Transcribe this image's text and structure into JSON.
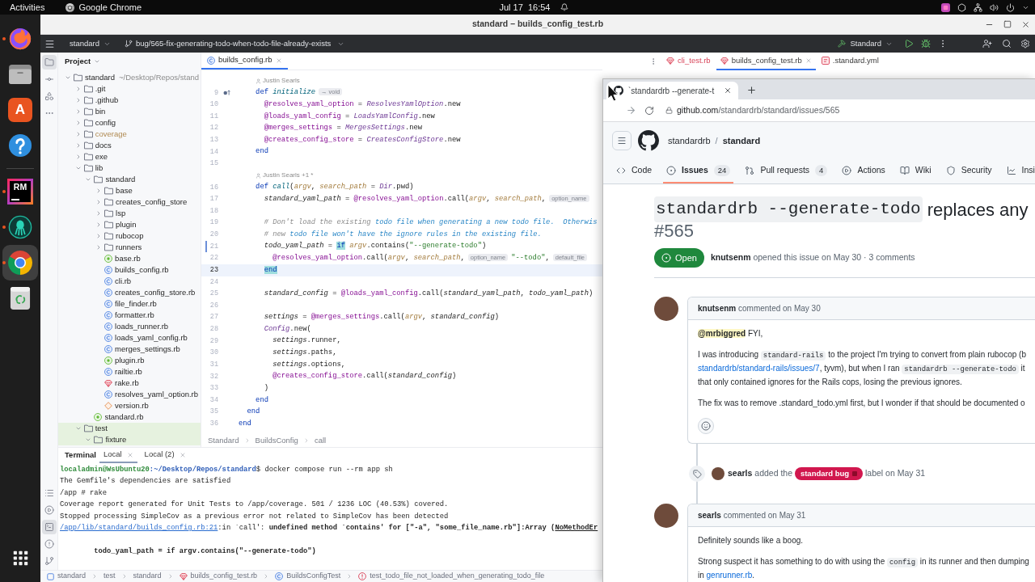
{
  "topbar": {
    "activities": "Activities",
    "app": "Google Chrome",
    "clock": "Jul 17  16:54"
  },
  "dock": [
    {
      "kind": "firefox",
      "running": true,
      "selected": false
    },
    {
      "kind": "files",
      "running": false,
      "selected": false
    },
    {
      "kind": "store",
      "label": "A",
      "running": false,
      "selected": false
    },
    {
      "kind": "help",
      "running": false,
      "selected": false
    },
    {
      "kind": "separator"
    },
    {
      "kind": "rubymine",
      "label": "RM",
      "running": true,
      "selected": false
    },
    {
      "kind": "kraken",
      "running": true,
      "selected": false
    },
    {
      "kind": "chrome",
      "running": true,
      "selected": true
    },
    {
      "kind": "trash",
      "running": false,
      "selected": false
    },
    {
      "kind": "grid",
      "selected": false
    }
  ],
  "ide": {
    "title": "standard – builds_config_test.rb",
    "project_widget": "standard",
    "branch": "bug/565-fix-generating-todo-when-todo-file-already-exists",
    "run_config": "Standard",
    "strip_top": [
      {
        "kind": "project",
        "selected": true
      },
      {
        "kind": "commit",
        "selected": false
      },
      {
        "kind": "structure",
        "selected": false
      },
      {
        "kind": "more",
        "selected": false
      }
    ],
    "strip_bottom": [
      {
        "kind": "services",
        "selected": false
      },
      {
        "kind": "run",
        "selected": false
      },
      {
        "kind": "terminal",
        "selected": true
      },
      {
        "kind": "problems",
        "selected": false
      },
      {
        "kind": "git",
        "selected": false
      }
    ],
    "project": {
      "title": "Project",
      "tree": [
        {
          "name": "standard",
          "path": "~/Desktop/Repos/stand",
          "kind": "folder",
          "expanded": true,
          "children": [
            {
              "name": ".git",
              "kind": "folder",
              "expanded": false
            },
            {
              "name": ".github",
              "kind": "folder",
              "expanded": false
            },
            {
              "name": "bin",
              "kind": "folder",
              "expanded": false
            },
            {
              "name": "config",
              "kind": "folder",
              "expanded": false
            },
            {
              "name": "coverage",
              "kind": "folder",
              "expanded": false,
              "excluded": true
            },
            {
              "name": "docs",
              "kind": "folder",
              "expanded": false
            },
            {
              "name": "exe",
              "kind": "folder",
              "expanded": false
            },
            {
              "name": "lib",
              "kind": "folder",
              "expanded": true,
              "children": [
                {
                  "name": "standard",
                  "kind": "folder",
                  "expanded": true,
                  "children": [
                    {
                      "name": "base",
                      "kind": "folder",
                      "expanded": false
                    },
                    {
                      "name": "creates_config_store",
                      "kind": "folder",
                      "expanded": false
                    },
                    {
                      "name": "lsp",
                      "kind": "folder",
                      "expanded": false
                    },
                    {
                      "name": "plugin",
                      "kind": "folder",
                      "expanded": false
                    },
                    {
                      "name": "rubocop",
                      "kind": "folder",
                      "expanded": false
                    },
                    {
                      "name": "runners",
                      "kind": "folder",
                      "expanded": false
                    },
                    {
                      "name": "base.rb",
                      "kind": "module"
                    },
                    {
                      "name": "builds_config.rb",
                      "kind": "class"
                    },
                    {
                      "name": "cli.rb",
                      "kind": "class"
                    },
                    {
                      "name": "creates_config_store.rb",
                      "kind": "class"
                    },
                    {
                      "name": "file_finder.rb",
                      "kind": "class"
                    },
                    {
                      "name": "formatter.rb",
                      "kind": "class"
                    },
                    {
                      "name": "loads_runner.rb",
                      "kind": "class"
                    },
                    {
                      "name": "loads_yaml_config.rb",
                      "kind": "class"
                    },
                    {
                      "name": "merges_settings.rb",
                      "kind": "class"
                    },
                    {
                      "name": "plugin.rb",
                      "kind": "module"
                    },
                    {
                      "name": "railtie.rb",
                      "kind": "class"
                    },
                    {
                      "name": "rake.rb",
                      "kind": "ruby"
                    },
                    {
                      "name": "resolves_yaml_option.rb",
                      "kind": "class"
                    },
                    {
                      "name": "version.rb",
                      "kind": "diamond"
                    }
                  ]
                },
                {
                  "name": "standard.rb",
                  "kind": "module"
                }
              ]
            },
            {
              "name": "test",
              "kind": "folder",
              "expanded": true,
              "test_scope": true,
              "children": [
                {
                  "name": "fixture",
                  "kind": "folder",
                  "expanded": true,
                  "test_scope": true
                }
              ]
            }
          ]
        }
      ]
    },
    "editor": {
      "tabs": [
        {
          "label": "builds_config.rb",
          "kind": "class",
          "selected": true
        }
      ],
      "lines": [
        {
          "kind": "author",
          "text": "Justin Searls"
        },
        {
          "kind": "code",
          "number": "9",
          "current": false,
          "override_marker": true,
          "tokens": [
            {
              "kind": "keyword",
              "text": "    def "
            },
            {
              "kind": "method",
              "text": "initialize"
            },
            {
              "kind": "hint",
              "text": "→ void"
            }
          ]
        },
        {
          "kind": "code",
          "number": "10",
          "current": false,
          "tokens": [
            {
              "kind": "ivar",
              "text": "      @resolves_yaml_option"
            },
            {
              "kind": "plain",
              "text": " = "
            },
            {
              "kind": "constant",
              "text": "ResolvesYamlOption"
            },
            {
              "kind": "plain",
              "text": ".new"
            }
          ]
        },
        {
          "kind": "code",
          "number": "11",
          "current": false,
          "tokens": [
            {
              "kind": "ivar",
              "text": "      @loads_yaml_config"
            },
            {
              "kind": "plain",
              "text": " = "
            },
            {
              "kind": "constant",
              "text": "LoadsYamlConfig"
            },
            {
              "kind": "plain",
              "text": ".new"
            }
          ]
        },
        {
          "kind": "code",
          "number": "12",
          "current": false,
          "tokens": [
            {
              "kind": "ivar",
              "text": "      @merges_settings"
            },
            {
              "kind": "plain",
              "text": " = "
            },
            {
              "kind": "constant",
              "text": "MergesSettings"
            },
            {
              "kind": "plain",
              "text": ".new"
            }
          ]
        },
        {
          "kind": "code",
          "number": "13",
          "current": false,
          "tokens": [
            {
              "kind": "ivar",
              "text": "      @creates_config_store"
            },
            {
              "kind": "plain",
              "text": " = "
            },
            {
              "kind": "constant",
              "text": "CreatesConfigStore"
            },
            {
              "kind": "plain",
              "text": ".new"
            }
          ]
        },
        {
          "kind": "code",
          "number": "14",
          "current": false,
          "tokens": [
            {
              "kind": "keyword",
              "text": "    end"
            }
          ]
        },
        {
          "kind": "code",
          "number": "15",
          "current": false
        },
        {
          "kind": "author",
          "text": "Justin Searls +1 *"
        },
        {
          "kind": "code",
          "number": "16",
          "current": false,
          "tokens": [
            {
              "kind": "keyword",
              "text": "    def "
            },
            {
              "kind": "method",
              "text": "call"
            },
            {
              "kind": "plain",
              "text": "("
            },
            {
              "kind": "param",
              "text": "argv"
            },
            {
              "kind": "plain",
              "text": ", "
            },
            {
              "kind": "param",
              "text": "search_path"
            },
            {
              "kind": "plain",
              "text": " = "
            },
            {
              "kind": "constant",
              "text": "Dir"
            },
            {
              "kind": "plain",
              "text": ".pwd)"
            }
          ]
        },
        {
          "kind": "code",
          "number": "17",
          "current": false,
          "tokens": [
            {
              "kind": "local",
              "text": "      standard_yaml_path"
            },
            {
              "kind": "plain",
              "text": " = "
            },
            {
              "kind": "ivar",
              "text": "@resolves_yaml_option"
            },
            {
              "kind": "plain",
              "text": ".call("
            },
            {
              "kind": "param",
              "text": "argv"
            },
            {
              "kind": "plain",
              "text": ", "
            },
            {
              "kind": "param",
              "text": "search_path"
            },
            {
              "kind": "plain",
              "text": ","
            },
            {
              "kind": "hint",
              "text": "option_name"
            }
          ]
        },
        {
          "kind": "code",
          "number": "18",
          "current": false
        },
        {
          "kind": "code",
          "number": "19",
          "current": false,
          "tokens": [
            {
              "kind": "comment",
              "text": "      # Don't load the existing "
            },
            {
              "kind": "todo",
              "text": "todo file when generating a new todo file.  Otherwis"
            }
          ]
        },
        {
          "kind": "code",
          "number": "20",
          "current": false,
          "tokens": [
            {
              "kind": "comment",
              "text": "      # new "
            },
            {
              "kind": "todo",
              "text": "todo file won't have the ignore rules in the existing file."
            }
          ]
        },
        {
          "kind": "code",
          "number": "21",
          "current": false,
          "changed": true,
          "tokens": [
            {
              "kind": "local",
              "text": "      todo_yaml_path"
            },
            {
              "kind": "plain",
              "text": " = "
            },
            {
              "kind": "match",
              "text": "if"
            },
            {
              "kind": "param",
              "text": " argv"
            },
            {
              "kind": "plain",
              "text": ".contains("
            },
            {
              "kind": "string",
              "text": "\"--generate-todo\""
            },
            {
              "kind": "plain",
              "text": ")"
            }
          ]
        },
        {
          "kind": "code",
          "number": "22",
          "current": false,
          "tokens": [
            {
              "kind": "ivar",
              "text": "        @resolves_yaml_option"
            },
            {
              "kind": "plain",
              "text": ".call("
            },
            {
              "kind": "param",
              "text": "argv"
            },
            {
              "kind": "plain",
              "text": ", "
            },
            {
              "kind": "param",
              "text": "search_path"
            },
            {
              "kind": "plain",
              "text": ","
            },
            {
              "kind": "hint",
              "text": "option_name"
            },
            {
              "kind": "string",
              "text": "\"--todo\""
            },
            {
              "kind": "plain",
              "text": ","
            },
            {
              "kind": "hint",
              "text": "default_file"
            }
          ]
        },
        {
          "kind": "code",
          "number": "23",
          "current": true,
          "tokens": [
            {
              "kind": "match",
              "text": "      end"
            }
          ]
        },
        {
          "kind": "code",
          "number": "24",
          "current": false
        },
        {
          "kind": "code",
          "number": "25",
          "current": false,
          "tokens": [
            {
              "kind": "local",
              "text": "      standard_config"
            },
            {
              "kind": "plain",
              "text": " = "
            },
            {
              "kind": "ivar",
              "text": "@loads_yaml_config"
            },
            {
              "kind": "plain",
              "text": ".call("
            },
            {
              "kind": "local",
              "text": "standard_yaml_path"
            },
            {
              "kind": "plain",
              "text": ", "
            },
            {
              "kind": "local",
              "text": "todo_yaml_path"
            },
            {
              "kind": "plain",
              "text": ")"
            }
          ]
        },
        {
          "kind": "code",
          "number": "26",
          "current": false
        },
        {
          "kind": "code",
          "number": "27",
          "current": false,
          "tokens": [
            {
              "kind": "local",
              "text": "      settings"
            },
            {
              "kind": "plain",
              "text": " = "
            },
            {
              "kind": "ivar",
              "text": "@merges_settings"
            },
            {
              "kind": "plain",
              "text": ".call("
            },
            {
              "kind": "param",
              "text": "argv"
            },
            {
              "kind": "plain",
              "text": ", "
            },
            {
              "kind": "local",
              "text": "standard_config"
            },
            {
              "kind": "plain",
              "text": ")"
            }
          ]
        },
        {
          "kind": "code",
          "number": "28",
          "current": false,
          "tokens": [
            {
              "kind": "constant",
              "text": "      Config"
            },
            {
              "kind": "plain",
              "text": ".new("
            }
          ]
        },
        {
          "kind": "code",
          "number": "29",
          "current": false,
          "tokens": [
            {
              "kind": "local",
              "text": "        settings"
            },
            {
              "kind": "plain",
              "text": ".runner,"
            }
          ]
        },
        {
          "kind": "code",
          "number": "30",
          "current": false,
          "tokens": [
            {
              "kind": "local",
              "text": "        settings"
            },
            {
              "kind": "plain",
              "text": ".paths,"
            }
          ]
        },
        {
          "kind": "code",
          "number": "31",
          "current": false,
          "tokens": [
            {
              "kind": "local",
              "text": "        settings"
            },
            {
              "kind": "plain",
              "text": ".options,"
            }
          ]
        },
        {
          "kind": "code",
          "number": "32",
          "current": false,
          "tokens": [
            {
              "kind": "ivar",
              "text": "        @creates_config_store"
            },
            {
              "kind": "plain",
              "text": ".call("
            },
            {
              "kind": "local",
              "text": "standard_config"
            },
            {
              "kind": "plain",
              "text": ")"
            }
          ]
        },
        {
          "kind": "code",
          "number": "33",
          "current": false,
          "tokens": [
            {
              "kind": "plain",
              "text": "      )"
            }
          ]
        },
        {
          "kind": "code",
          "number": "34",
          "current": false,
          "tokens": [
            {
              "kind": "keyword",
              "text": "    end"
            }
          ]
        },
        {
          "kind": "code",
          "number": "35",
          "current": false,
          "tokens": [
            {
              "kind": "keyword",
              "text": "  end"
            }
          ]
        },
        {
          "kind": "code",
          "number": "36",
          "current": false,
          "tokens": [
            {
              "kind": "keyword",
              "text": "end"
            }
          ]
        }
      ],
      "breadcrumb": [
        "Standard",
        "BuildsConfig",
        "call"
      ]
    },
    "second_pane": {
      "tabs": [
        {
          "label": "cli_test.rb",
          "kind": "ruby",
          "selected": false,
          "error": true
        },
        {
          "label": "builds_config_test.rb",
          "kind": "ruby",
          "selected": true,
          "error": false
        },
        {
          "label": ".standard.yml",
          "kind": "yaml",
          "selected": false,
          "error": false
        }
      ]
    },
    "terminal": {
      "title": "Terminal",
      "tabs": [
        {
          "label": "Local",
          "selected": true
        },
        {
          "label": "Local (2)",
          "selected": false
        }
      ],
      "lines": [
        {
          "kind": "text",
          "segments": [
            {
              "kind": "user",
              "text": "localadmin@WsUbuntu20"
            },
            {
              "kind": "path",
              "text": ":~/Desktop/Repos/standard"
            },
            {
              "kind": "plain",
              "text": "$ docker compose run --rm app sh"
            }
          ]
        },
        {
          "kind": "text",
          "segments": [
            {
              "kind": "plain",
              "text": "The Gemfile's dependencies are satisfied"
            }
          ]
        },
        {
          "kind": "text",
          "segments": [
            {
              "kind": "plain",
              "text": "/app # rake"
            }
          ]
        },
        {
          "kind": "text",
          "segments": [
            {
              "kind": "plain",
              "text": "Coverage report generated for Unit Tests to /app/coverage. 501 / 1236 LOC (40.53%) covered."
            }
          ]
        },
        {
          "kind": "text",
          "segments": [
            {
              "kind": "plain",
              "text": "Stopped processing SimpleCov as a previous error not related to SimpleCov has been detected"
            }
          ]
        },
        {
          "kind": "text",
          "segments": [
            {
              "kind": "link",
              "text": "/app/lib/standard/builds_config.rb:21"
            },
            {
              "kind": "plain",
              "text": ":in `call': "
            },
            {
              "kind": "bold",
              "text": "undefined method `contains' for [\"-a\", \"some_file_name.rb\"]:Array ("
            },
            {
              "kind": "bold_underline",
              "text": "NoMethodEr"
            }
          ]
        },
        {
          "kind": "blank"
        },
        {
          "kind": "text",
          "segments": [
            {
              "kind": "bold",
              "text": "        todo_yaml_path = if argv.contains(\"--generate-todo\")"
            }
          ]
        }
      ]
    },
    "status_path": [
      {
        "label": "standard",
        "kind": "project"
      },
      {
        "label": "test",
        "kind": "plain"
      },
      {
        "label": "standard",
        "kind": "plain"
      },
      {
        "label": "builds_config_test.rb",
        "kind": "ruby"
      },
      {
        "label": "BuildsConfigTest",
        "kind": "class"
      },
      {
        "label": "test_todo_file_not_loaded_when_generating_todo_file",
        "kind": "error"
      }
    ]
  },
  "browser": {
    "tab": {
      "title": "`standardrb --generate-t",
      "selected": true
    },
    "url": {
      "host": "github.com",
      "path": "/standardrb/standard/issues/565"
    },
    "repo": {
      "owner": "standardrb",
      "separator": "/",
      "name": "standard"
    },
    "nav": [
      {
        "kind": "code",
        "label": "Code",
        "selected": false
      },
      {
        "kind": "issues",
        "label": "Issues",
        "count": "24",
        "selected": true
      },
      {
        "kind": "pulls",
        "label": "Pull requests",
        "count": "4",
        "selected": false
      },
      {
        "kind": "actions",
        "label": "Actions",
        "selected": false
      },
      {
        "kind": "wiki",
        "label": "Wiki",
        "selected": false
      },
      {
        "kind": "security",
        "label": "Security",
        "selected": false
      },
      {
        "kind": "insights",
        "label": "Insi",
        "selected": false
      }
    ],
    "issue": {
      "title": [
        {
          "kind": "code",
          "text": "standardrb --generate-todo"
        },
        {
          "kind": "text",
          "text": " replaces any"
        }
      ],
      "number": "#565",
      "open": true,
      "state_label": "Open",
      "author": "knutsenm",
      "meta": "opened this issue on May 30 · 3 comments"
    },
    "timeline": [
      {
        "kind": "comment",
        "author": "knutsenm",
        "meta": "commented on May 30",
        "reactions": true,
        "paragraphs": [
          [
            [
              {
                "kind": "mention",
                "text": "@mrbiggred"
              },
              {
                "kind": "text",
                "text": " FYI,"
              }
            ]
          ],
          [
            [
              {
                "kind": "text",
                "text": "I was introducing "
              },
              {
                "kind": "code",
                "text": "standard-rails"
              },
              {
                "kind": "text",
                "text": " to the project I'm trying to convert from plain rubocop (b"
              }
            ],
            [
              {
                "kind": "link",
                "text": "standardrb/standard-rails/issues/7"
              },
              {
                "kind": "text",
                "text": ", tyvm), but when I ran "
              },
              {
                "kind": "code",
                "text": "standardrb --generate-todo"
              },
              {
                "kind": "text",
                "text": " it"
              }
            ],
            [
              {
                "kind": "text",
                "text": "that only contained ignores for the Rails cops, losing the previous ignores."
              }
            ]
          ],
          [
            [
              {
                "kind": "text",
                "text": "The fix was to remove .standard_todo.yml first, but I wonder if that should be documented o"
              }
            ]
          ]
        ]
      },
      {
        "kind": "event",
        "actor": "searls",
        "before": " added the ",
        "label": {
          "text": "standard bug",
          "color": "#d1174e"
        },
        "after": " label on May 31"
      },
      {
        "kind": "comment",
        "author": "searls",
        "meta": "commented on May 31",
        "paragraphs": [
          [
            [
              {
                "kind": "text",
                "text": "Definitely sounds like a boog."
              }
            ]
          ],
          [
            [
              {
                "kind": "text",
                "text": "Strong suspect it has something to do with using the "
              },
              {
                "kind": "code",
                "text": "config"
              },
              {
                "kind": "text",
                "text": " in its runner and then dumping"
              }
            ],
            [
              {
                "kind": "text",
                "text": "in "
              },
              {
                "kind": "link",
                "text": "genrunner.rb"
              },
              {
                "kind": "text",
                "text": "."
              }
            ]
          ]
        ]
      }
    ]
  }
}
